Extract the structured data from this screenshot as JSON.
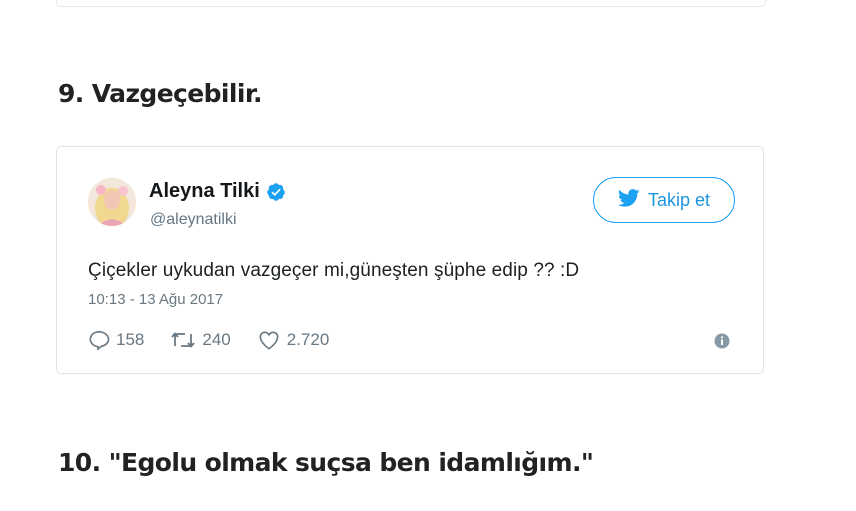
{
  "section_9": {
    "heading": "9. Vazgeçebilir."
  },
  "tweet": {
    "author_name": "Aleyna Tilki",
    "author_handle": "@aleynatilki",
    "follow_label": "Takip et",
    "text": "Çiçekler uykudan vazgeçer mi,güneşten şüphe edip ?? :D",
    "timestamp": "10:13 - 13 Ağu 2017",
    "replies": "158",
    "retweets": "240",
    "likes": "2.720"
  },
  "section_10": {
    "heading": "10. \"Egolu olmak suçsa ben idamlığım.\""
  },
  "colors": {
    "twitter_blue": "#1da1f2",
    "muted_text": "#697882",
    "border": "#e1e8ed"
  }
}
